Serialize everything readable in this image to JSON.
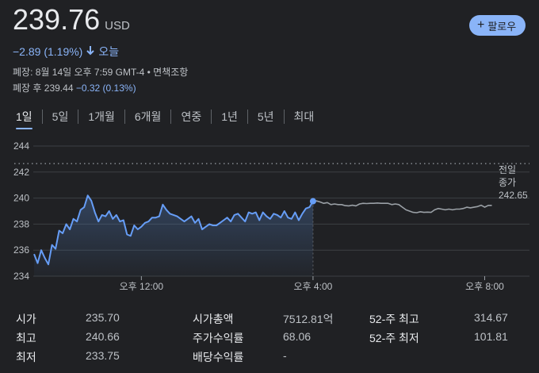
{
  "header": {
    "price": "239.76",
    "currency": "USD",
    "follow_label": "팔로우",
    "follow_icon": "plus-icon",
    "change": "−2.89 (1.19%)",
    "change_period": "오늘",
    "change_icon": "arrow-down-icon",
    "close_info": "폐장: 8월 14일 오후 7:59 GMT-4 • 면책조항",
    "after_hours_label": "폐장 후 239.44",
    "after_hours_change": "−0.32 (0.13%)"
  },
  "tabs": [
    {
      "label": "1일",
      "active": true
    },
    {
      "label": "5일",
      "active": false
    },
    {
      "label": "1개월",
      "active": false
    },
    {
      "label": "6개월",
      "active": false
    },
    {
      "label": "연중",
      "active": false
    },
    {
      "label": "1년",
      "active": false
    },
    {
      "label": "5년",
      "active": false
    },
    {
      "label": "최대",
      "active": false
    }
  ],
  "chart_data": {
    "type": "line",
    "ylim": [
      234,
      244
    ],
    "yticks": [
      234,
      236,
      238,
      240,
      242,
      244
    ],
    "ytick_labels": [
      "234",
      "236",
      "238",
      "240",
      "242",
      "244"
    ],
    "xlim": [
      570,
      1215
    ],
    "xticks": [
      720,
      960,
      1200
    ],
    "xtick_labels": [
      "오후 12:00",
      "오후 4:00",
      "오후 8:00"
    ],
    "previous_close": 242.65,
    "previous_close_label": [
      "전일",
      "종가",
      "242.65"
    ],
    "colors": {
      "regular": "#669df6",
      "after_hours": "#9aa0a6",
      "grid": "#3c4043"
    },
    "series": [
      {
        "session": "regular",
        "x": [
          570,
          575,
          580,
          585,
          590,
          595,
          600,
          605,
          610,
          615,
          620,
          625,
          630,
          635,
          640,
          645,
          650,
          655,
          660,
          665,
          670,
          675,
          680,
          685,
          690,
          695,
          700,
          705,
          710,
          715,
          720,
          725,
          730,
          735,
          740,
          745,
          750,
          755,
          760,
          765,
          770,
          775,
          780,
          785,
          790,
          795,
          800,
          805,
          810,
          815,
          820,
          825,
          830,
          835,
          840,
          845,
          850,
          855,
          860,
          865,
          870,
          875,
          880,
          885,
          890,
          895,
          900,
          905,
          910,
          915,
          920,
          925,
          930,
          935,
          940,
          945,
          950,
          955,
          960
        ],
        "y": [
          235.7,
          235.0,
          236.0,
          235.4,
          234.9,
          236.4,
          236.1,
          237.5,
          237.3,
          238.0,
          237.6,
          238.4,
          238.2,
          239.1,
          239.3,
          240.2,
          239.8,
          238.9,
          238.2,
          238.7,
          238.6,
          239.0,
          238.4,
          238.7,
          238.2,
          238.3,
          237.2,
          237.1,
          237.9,
          237.6,
          237.8,
          238.1,
          238.2,
          238.5,
          238.5,
          238.6,
          239.5,
          239.1,
          238.8,
          238.7,
          238.6,
          238.4,
          238.2,
          238.4,
          238.6,
          238.1,
          238.4,
          237.6,
          237.8,
          238.0,
          237.9,
          237.9,
          238.1,
          238.3,
          238.5,
          238.2,
          238.7,
          238.8,
          238.5,
          238.2,
          238.9,
          238.8,
          238.9,
          238.3,
          238.9,
          238.6,
          238.4,
          238.8,
          238.7,
          238.5,
          239.0,
          238.5,
          238.4,
          238.9,
          238.3,
          238.8,
          239.2,
          239.3,
          239.76
        ]
      },
      {
        "session": "after_hours",
        "x": [
          960,
          965,
          970,
          975,
          980,
          985,
          990,
          995,
          1000,
          1005,
          1010,
          1015,
          1020,
          1025,
          1030,
          1035,
          1040,
          1045,
          1050,
          1055,
          1060,
          1065,
          1070,
          1075,
          1080,
          1085,
          1090,
          1095,
          1100,
          1105,
          1110,
          1115,
          1120,
          1125,
          1130,
          1135,
          1140,
          1145,
          1150,
          1155,
          1160,
          1165,
          1170,
          1175,
          1180,
          1185,
          1190,
          1195,
          1200,
          1205,
          1210
        ],
        "y": [
          239.76,
          239.78,
          239.7,
          239.6,
          239.65,
          239.5,
          239.55,
          239.5,
          239.5,
          239.42,
          239.4,
          239.45,
          239.4,
          239.55,
          239.6,
          239.58,
          239.6,
          239.6,
          239.62,
          239.6,
          239.6,
          239.6,
          239.5,
          239.55,
          239.5,
          239.3,
          239.1,
          239.0,
          238.9,
          238.88,
          238.95,
          238.9,
          238.92,
          238.9,
          239.1,
          239.2,
          239.15,
          239.1,
          239.15,
          239.1,
          239.15,
          239.15,
          239.2,
          239.3,
          239.25,
          239.3,
          239.35,
          239.45,
          239.3,
          239.44,
          239.44
        ]
      }
    ],
    "current_point": {
      "x": 960,
      "y": 239.76
    }
  },
  "stats": [
    {
      "key": "시가",
      "value": "235.70"
    },
    {
      "key": "최고",
      "value": "240.66"
    },
    {
      "key": "최저",
      "value": "233.75"
    },
    {
      "key": "시가총액",
      "value": "7512.81억"
    },
    {
      "key": "주가수익률",
      "value": "68.06"
    },
    {
      "key": "배당수익률",
      "value": "-"
    },
    {
      "key": "52-주 최고",
      "value": "314.67"
    },
    {
      "key": "52-주 최저",
      "value": "101.81"
    }
  ]
}
